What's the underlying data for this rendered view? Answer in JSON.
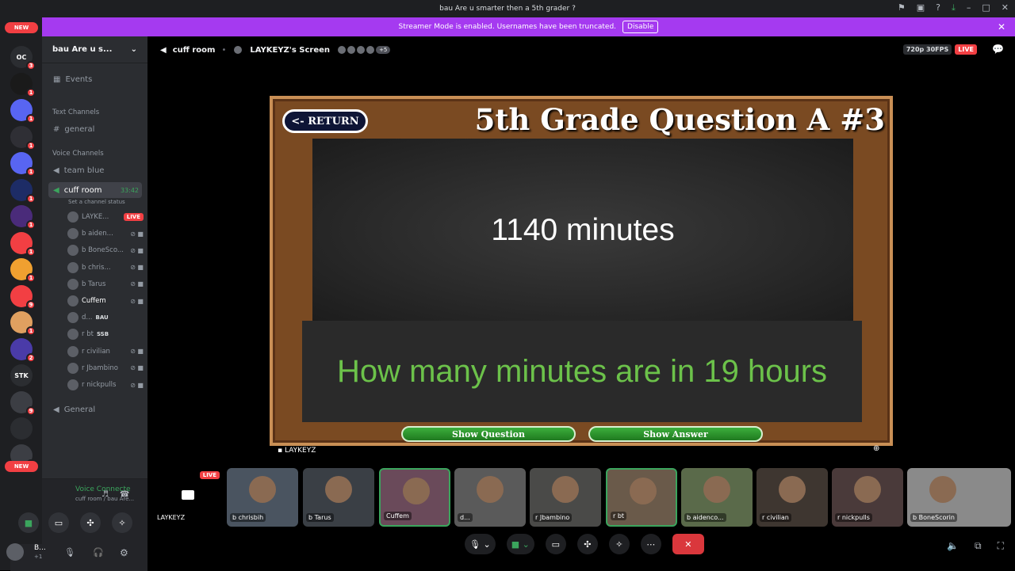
{
  "titlebar": {
    "title": "bau Are u smarter then a 5th grader ?"
  },
  "banner": {
    "text": "Streamer Mode is enabled. Usernames have been truncated.",
    "button": "Disable"
  },
  "guilds": {
    "new_top": "NEW",
    "new_bottom": "NEW",
    "items": [
      {
        "label": "OC",
        "badge": "3"
      },
      {
        "label": "",
        "badge": "1"
      },
      {
        "label": "",
        "badge": "1"
      },
      {
        "label": "",
        "badge": "1"
      },
      {
        "label": "",
        "badge": "1"
      },
      {
        "label": "",
        "badge": "1"
      },
      {
        "label": "",
        "badge": "1"
      },
      {
        "label": "",
        "badge": "1"
      },
      {
        "label": "",
        "badge": "1"
      },
      {
        "label": "",
        "badge": "9"
      },
      {
        "label": "",
        "badge": "1"
      },
      {
        "label": "",
        "badge": "2"
      },
      {
        "label": "STK",
        "badge": ""
      },
      {
        "label": "",
        "badge": "9"
      },
      {
        "label": "",
        "badge": ""
      },
      {
        "label": "",
        "badge": "9"
      }
    ]
  },
  "sidebar": {
    "server": "bau Are u s...",
    "events": "Events",
    "text_channels": "Text Channels",
    "general": "general",
    "voice_channels": "Voice Channels",
    "team_blue": "team blue",
    "cuff_room": "cuff room",
    "cuff_timer": "33:42",
    "status_hint": "Set a channel status",
    "users": [
      {
        "name": "LAYKE...",
        "tag": "LIVE"
      },
      {
        "name": "b aiden...",
        "tag": ""
      },
      {
        "name": "b BoneSco...",
        "tag": ""
      },
      {
        "name": "b chris...",
        "tag": ""
      },
      {
        "name": "b Tarus",
        "tag": ""
      },
      {
        "name": "Cuffem",
        "tag": ""
      },
      {
        "name": "d...",
        "tag": "BAU"
      },
      {
        "name": "r bt",
        "tag": "SSB"
      },
      {
        "name": "r civilian",
        "tag": ""
      },
      {
        "name": "r Jbambino",
        "tag": ""
      },
      {
        "name": "r nickpulls",
        "tag": ""
      }
    ],
    "General": "General",
    "voice": {
      "status": "Voice Connecte",
      "location": "cuff room / bau Are...",
      "user": "B...",
      "user_sub": "+1"
    }
  },
  "stage": {
    "channel": "cuff room",
    "screen_owner": "LAYKEYZ's Screen",
    "extra": "+5",
    "quality": "720p 30FPS",
    "live": "LIVE",
    "screen_label": "LAYKEYZ"
  },
  "game": {
    "return": "<- RETURN",
    "title": "5th Grade Question A #3",
    "answer": "1140 minutes",
    "question": "How many minutes are in 19 hours",
    "show_question": "Show Question",
    "show_answer": "Show Answer"
  },
  "tiles": [
    {
      "name": "LAYKEYZ",
      "live": "LIVE"
    },
    {
      "name": "b chrisbih"
    },
    {
      "name": "b Tarus"
    },
    {
      "name": "Cuffem"
    },
    {
      "name": "d..."
    },
    {
      "name": "r Jbambino"
    },
    {
      "name": "r bt"
    },
    {
      "name": "b aidenco..."
    },
    {
      "name": "r civilian"
    },
    {
      "name": "r nickpulls"
    },
    {
      "name": "b BoneScorin"
    }
  ]
}
